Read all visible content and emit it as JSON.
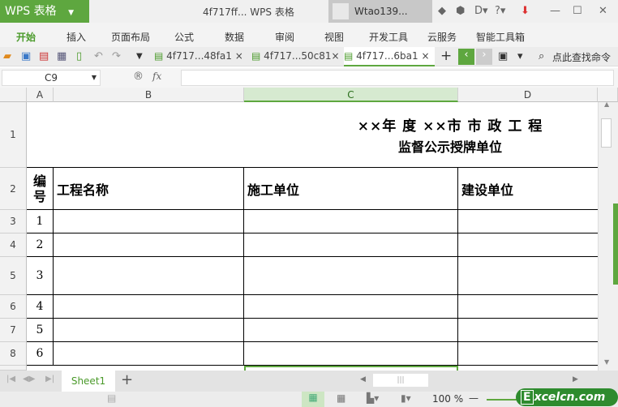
{
  "app": {
    "name": "WPS 表格",
    "doc_title": "4f717ff... WPS 表格",
    "user": "Wtao139..."
  },
  "ribbon": {
    "tabs": [
      "开始",
      "插入",
      "页面布局",
      "公式",
      "数据",
      "审阅",
      "视图",
      "开发工具",
      "云服务",
      "智能工具箱"
    ]
  },
  "doc_tabs": [
    "4f717...48fa1",
    "4f717...50c81",
    "4f717...6ba1"
  ],
  "search": {
    "label": "点此查找命令"
  },
  "formula_bar": {
    "cell_ref": "C9",
    "fx": "fx",
    "value": ""
  },
  "columns": [
    "A",
    "B",
    "C",
    "D"
  ],
  "rows": [
    "1",
    "2",
    "3",
    "4",
    "5",
    "6",
    "7",
    "8"
  ],
  "sheet": {
    "title_line1": "××年 度 ××市 市 政 工 程",
    "title_line2": "监督公示授牌单位",
    "headers": [
      "编号",
      "工程名称",
      "施工单位",
      "建设单位"
    ],
    "numbers": [
      "1",
      "2",
      "3",
      "4",
      "5",
      "6"
    ]
  },
  "sheet_tabs": [
    "Sheet1"
  ],
  "status": {
    "zoom": "100 %"
  },
  "watermark": "Excelcn.com",
  "colors": {
    "accent": "#5ea73f"
  }
}
